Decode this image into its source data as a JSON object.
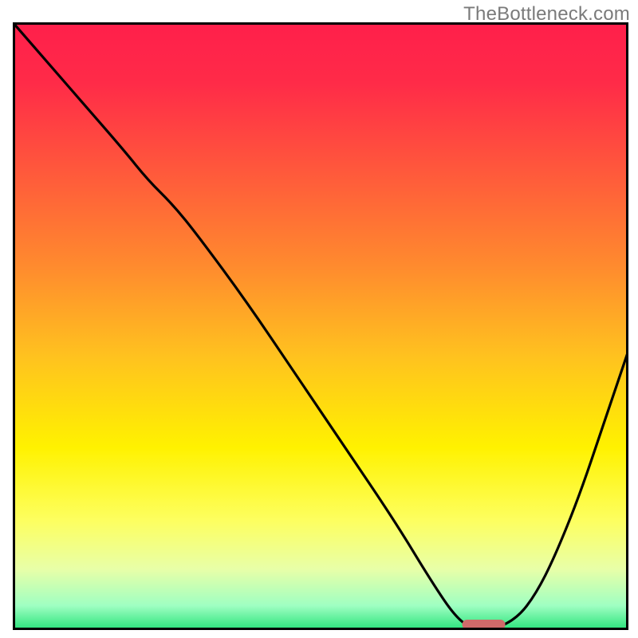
{
  "watermark": "TheBottleneck.com",
  "chart_data": {
    "type": "line",
    "title": "",
    "xlabel": "",
    "ylabel": "",
    "xlim": [
      0,
      100
    ],
    "ylim": [
      0,
      100
    ],
    "grid": false,
    "legend": false,
    "background_gradient_stops": [
      {
        "offset": 0.0,
        "color": "#ff1f4b"
      },
      {
        "offset": 0.1,
        "color": "#ff2b48"
      },
      {
        "offset": 0.25,
        "color": "#ff5a3b"
      },
      {
        "offset": 0.4,
        "color": "#ff8a2e"
      },
      {
        "offset": 0.55,
        "color": "#ffc21f"
      },
      {
        "offset": 0.7,
        "color": "#fff200"
      },
      {
        "offset": 0.82,
        "color": "#fdff60"
      },
      {
        "offset": 0.9,
        "color": "#e8ffa8"
      },
      {
        "offset": 0.96,
        "color": "#9fffc2"
      },
      {
        "offset": 1.0,
        "color": "#28e27a"
      }
    ],
    "series": [
      {
        "name": "bottleneck-curve",
        "color": "#000000",
        "x": [
          0,
          6,
          12,
          18,
          22,
          26,
          30,
          38,
          46,
          54,
          62,
          68,
          72,
          75,
          78,
          82,
          85,
          88,
          92,
          96,
          100
        ],
        "y": [
          100,
          93,
          86,
          79,
          74,
          70,
          65,
          54,
          42,
          30,
          18,
          8,
          2,
          0,
          0,
          2,
          6,
          12,
          22,
          34,
          46
        ]
      }
    ],
    "marker": {
      "name": "optimal-range",
      "color": "#d06a6a",
      "x_center": 76.5,
      "y": 0.9,
      "width": 7.0,
      "height": 1.6,
      "rx": 0.8
    },
    "axes_box": {
      "stroke": "#000000",
      "stroke_width": 3
    }
  }
}
